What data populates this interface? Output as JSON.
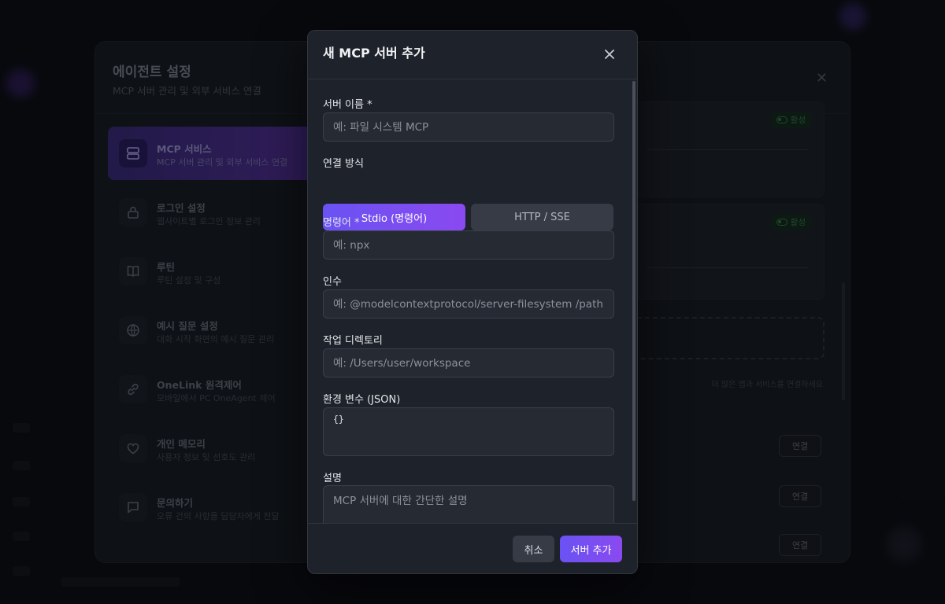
{
  "settings": {
    "title": "에이전트 설정",
    "subtitle": "MCP 서버 관리 및 외부 서비스 연결",
    "nav": [
      {
        "label": "MCP 서비스",
        "desc": "MCP 서버 관리 및 외부 서비스 연결",
        "icon": "server-icon",
        "active": true
      },
      {
        "label": "로그인 설정",
        "desc": "웹사이트별 로그인 정보 관리",
        "icon": "lock-icon"
      },
      {
        "label": "루틴",
        "desc": "루틴 설정 및 구성",
        "icon": "book-icon"
      },
      {
        "label": "예시 질문 설정",
        "desc": "대화 시작 화면의 예시 질문 관리",
        "icon": "globe-icon"
      },
      {
        "label": "OneLink 원격제어",
        "desc": "모바일에서 PC OneAgent 제어",
        "icon": "link-icon"
      },
      {
        "label": "개인 메모리",
        "desc": "사용자 정보 및 선호도 관리",
        "icon": "heart-icon"
      },
      {
        "label": "문의하기",
        "desc": "오류 건의 사항을 담당자에게 전달",
        "icon": "chat-icon"
      }
    ],
    "status_badge": "활성",
    "note": "더 많은 앱과 서비스를 연결하세요",
    "connect_label": "연결"
  },
  "modal": {
    "title": "새 MCP 서버 추가",
    "fields": {
      "name": {
        "label": "서버 이름 *",
        "placeholder": "예: 파일 시스템 MCP",
        "value": ""
      },
      "connection": {
        "label": "연결 방식",
        "options": [
          "Stdio (명령어)",
          "HTTP / SSE"
        ],
        "selected": "Stdio (명령어)"
      },
      "command": {
        "label": "명령어 *",
        "placeholder": "예: npx",
        "value": ""
      },
      "args": {
        "label": "인수",
        "placeholder": "예: @modelcontextprotocol/server-filesystem /path",
        "value": ""
      },
      "workdir": {
        "label": "작업 디렉토리",
        "placeholder": "예: /Users/user/workspace",
        "value": ""
      },
      "env": {
        "label": "환경 변수 (JSON)",
        "value": "{}"
      },
      "description": {
        "label": "설명",
        "placeholder": "MCP 서버에 대한 간단한 설명",
        "value": ""
      }
    },
    "footer": {
      "cancel": "취소",
      "submit": "서버 추가"
    }
  },
  "colors": {
    "accent": "#6a52f2",
    "accent_end": "#8a4af0",
    "modal_bg": "#1e222a",
    "status_green": "#2f6b43"
  }
}
